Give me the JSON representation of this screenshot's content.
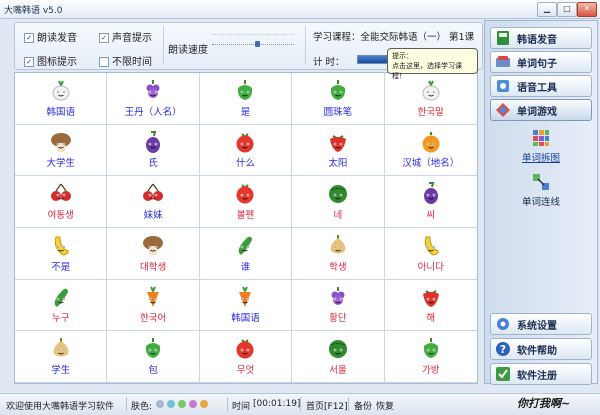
{
  "window": {
    "title": "大嘴韩语 v5.0",
    "minimize": "▁",
    "maximize": "□",
    "close": "✕"
  },
  "options": {
    "read_aloud": "朗读发音",
    "sound_hint": "声音提示",
    "icon_hint": "图标提示",
    "no_time_limit": "不限时间",
    "read_speed": "朗读速度",
    "course_label": "学习课程：全能交际韩语（一）  第1课",
    "timer_label": "计      时："
  },
  "tooltip": {
    "line1": "提示：",
    "line2": "点击这里，选择学习课程！"
  },
  "grid": [
    {
      "fruit": "radish",
      "text": "韩国语",
      "lang": "cn"
    },
    {
      "fruit": "grape",
      "text": "王丹（人名）",
      "lang": "cn"
    },
    {
      "fruit": "pepper",
      "text": "是",
      "lang": "cn"
    },
    {
      "fruit": "pepper",
      "text": "圆珠笔",
      "lang": "cn"
    },
    {
      "fruit": "radish",
      "text": "한국말",
      "lang": "kr"
    },
    {
      "fruit": "mushroom",
      "text": "大学生",
      "lang": "cn"
    },
    {
      "fruit": "eggplant",
      "text": "氏",
      "lang": "cn"
    },
    {
      "fruit": "tomato",
      "text": "什么",
      "lang": "cn"
    },
    {
      "fruit": "strawberry",
      "text": "太阳",
      "lang": "cn"
    },
    {
      "fruit": "orange",
      "text": "汉城（地名）",
      "lang": "cn"
    },
    {
      "fruit": "cherry",
      "text": "여동생",
      "lang": "kr"
    },
    {
      "fruit": "cherry",
      "text": "妹妹",
      "lang": "cn"
    },
    {
      "fruit": "tomato",
      "text": "볼펜",
      "lang": "kr"
    },
    {
      "fruit": "watermelon",
      "text": "네",
      "lang": "kr"
    },
    {
      "fruit": "eggplant",
      "text": "씨",
      "lang": "kr"
    },
    {
      "fruit": "banana",
      "text": "不是",
      "lang": "cn"
    },
    {
      "fruit": "mushroom",
      "text": "대학생",
      "lang": "kr"
    },
    {
      "fruit": "cucumber",
      "text": "谁",
      "lang": "cn"
    },
    {
      "fruit": "onion",
      "text": "학생",
      "lang": "kr"
    },
    {
      "fruit": "banana",
      "text": "아니다",
      "lang": "kr"
    },
    {
      "fruit": "cucumber",
      "text": "누구",
      "lang": "kr"
    },
    {
      "fruit": "carrot",
      "text": "한국어",
      "lang": "kr"
    },
    {
      "fruit": "carrot",
      "text": "韩国语",
      "lang": "cn"
    },
    {
      "fruit": "grape",
      "text": "황단",
      "lang": "kr"
    },
    {
      "fruit": "strawberry",
      "text": "해",
      "lang": "kr"
    },
    {
      "fruit": "onion",
      "text": "学生",
      "lang": "cn"
    },
    {
      "fruit": "pepper",
      "text": "包",
      "lang": "cn"
    },
    {
      "fruit": "tomato",
      "text": "무엇",
      "lang": "kr"
    },
    {
      "fruit": "watermelon",
      "text": "서울",
      "lang": "kr"
    },
    {
      "fruit": "pepper",
      "text": "가방",
      "lang": "kr"
    }
  ],
  "sidebar": {
    "nav": [
      {
        "label": "韩语发音",
        "icon": "book-icon"
      },
      {
        "label": "单词句子",
        "icon": "sentence-icon"
      },
      {
        "label": "语音工具",
        "icon": "tools-icon"
      },
      {
        "label": "单词游戏",
        "icon": "game-icon",
        "active": true
      }
    ],
    "games": [
      {
        "label": "单词拆图",
        "icon": "puzzle-icon"
      },
      {
        "label": "单词连线",
        "icon": "connect-icon"
      }
    ],
    "bottom": [
      {
        "label": "系统设置",
        "icon": "gear-icon"
      },
      {
        "label": "软件帮助",
        "icon": "help-icon"
      },
      {
        "label": "软件注册",
        "icon": "register-icon"
      }
    ]
  },
  "status": {
    "welcome": "欢迎使用大嘴韩语学习软件",
    "skin_label": "肤色:",
    "skin_colors": [
      "#a9b8cc",
      "#6ec3d8",
      "#7bc96a",
      "#c67ad2",
      "#e9a640"
    ],
    "time_label": "时间",
    "time_value": "[00:01:19]",
    "home": "首页[F12]",
    "backup": "备份",
    "restore": "恢复",
    "brand": "你打我啊~"
  },
  "colors": {
    "cn_text": "#2a2ae6",
    "kr_text": "#e1243c"
  }
}
